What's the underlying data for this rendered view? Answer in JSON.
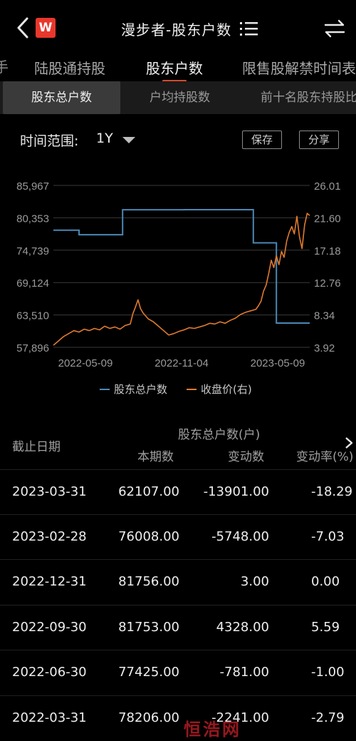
{
  "header": {
    "title": "漫步者-股东户数",
    "logo_text": "W"
  },
  "tabs": [
    {
      "label": "陆股通持股"
    },
    {
      "label": "股东户数"
    },
    {
      "label": "限售股解禁时间表"
    }
  ],
  "subtabs": [
    {
      "label": "股东总户数"
    },
    {
      "label": "户均持股数"
    },
    {
      "label": "前十名股东持股比例"
    }
  ],
  "range": {
    "label": "时间范围:",
    "value": "1Y",
    "save_label": "保存",
    "share_label": "分享"
  },
  "chart_data": {
    "type": "line",
    "left_axis_ticks": [
      "85,967",
      "80,353",
      "74,739",
      "69,124",
      "63,510",
      "57,896"
    ],
    "right_axis_ticks": [
      "26.01",
      "21.60",
      "17.18",
      "12.76",
      "8.34",
      "3.92"
    ],
    "x_tick_labels": [
      "2022-05-09",
      "2022-11-04",
      "2023-05-09"
    ],
    "ylim_left": [
      57896,
      85967
    ],
    "ylim_right": [
      3.92,
      26.01
    ],
    "legend": [
      "股东总户数",
      "收盘价(右)"
    ],
    "series": [
      {
        "name": "股东总户数",
        "color": "#4a88b5",
        "step_points": [
          [
            0,
            78206
          ],
          [
            0.1,
            78206
          ],
          [
            0.1,
            77425
          ],
          [
            0.27,
            77425
          ],
          [
            0.27,
            81753
          ],
          [
            0.51,
            81753
          ],
          [
            0.51,
            81756
          ],
          [
            0.78,
            81756
          ],
          [
            0.78,
            76008
          ],
          [
            0.87,
            76008
          ],
          [
            0.87,
            62107
          ],
          [
            1.0,
            62107
          ]
        ]
      },
      {
        "name": "收盘价(右)",
        "color": "#e07a2e",
        "points": [
          [
            0,
            4.2
          ],
          [
            0.02,
            4.8
          ],
          [
            0.04,
            5.4
          ],
          [
            0.06,
            5.8
          ],
          [
            0.08,
            6.2
          ],
          [
            0.1,
            6.0
          ],
          [
            0.12,
            6.4
          ],
          [
            0.14,
            6.2
          ],
          [
            0.16,
            6.5
          ],
          [
            0.18,
            6.3
          ],
          [
            0.2,
            6.8
          ],
          [
            0.22,
            6.5
          ],
          [
            0.24,
            6.7
          ],
          [
            0.26,
            6.4
          ],
          [
            0.28,
            6.9
          ],
          [
            0.3,
            7.1
          ],
          [
            0.31,
            8.5
          ],
          [
            0.32,
            9.4
          ],
          [
            0.33,
            10.4
          ],
          [
            0.34,
            9.2
          ],
          [
            0.35,
            8.6
          ],
          [
            0.37,
            7.8
          ],
          [
            0.39,
            7.4
          ],
          [
            0.41,
            6.8
          ],
          [
            0.43,
            6.2
          ],
          [
            0.45,
            5.6
          ],
          [
            0.47,
            5.8
          ],
          [
            0.49,
            6.1
          ],
          [
            0.51,
            6.3
          ],
          [
            0.53,
            6.6
          ],
          [
            0.55,
            6.5
          ],
          [
            0.57,
            6.7
          ],
          [
            0.59,
            6.9
          ],
          [
            0.61,
            7.2
          ],
          [
            0.63,
            7.1
          ],
          [
            0.65,
            7.4
          ],
          [
            0.67,
            7.2
          ],
          [
            0.69,
            7.6
          ],
          [
            0.71,
            7.9
          ],
          [
            0.73,
            8.4
          ],
          [
            0.75,
            8.7
          ],
          [
            0.77,
            8.9
          ],
          [
            0.79,
            9.1
          ],
          [
            0.8,
            9.6
          ],
          [
            0.81,
            10.2
          ],
          [
            0.82,
            11.6
          ],
          [
            0.83,
            12.4
          ],
          [
            0.84,
            14.0
          ],
          [
            0.85,
            15.8
          ],
          [
            0.86,
            14.8
          ],
          [
            0.87,
            16.4
          ],
          [
            0.88,
            15.2
          ],
          [
            0.89,
            17.0
          ],
          [
            0.9,
            16.2
          ],
          [
            0.91,
            18.4
          ],
          [
            0.92,
            19.6
          ],
          [
            0.93,
            20.4
          ],
          [
            0.94,
            19.4
          ],
          [
            0.95,
            21.8
          ],
          [
            0.96,
            19.0
          ],
          [
            0.97,
            17.4
          ],
          [
            0.98,
            20.6
          ],
          [
            0.99,
            22.2
          ],
          [
            1.0,
            21.9
          ]
        ]
      }
    ]
  },
  "table": {
    "date_header": "截止日期",
    "group_header": "股东总户数(户)",
    "col_headers": [
      "本期数",
      "变动数",
      "变动率(%)"
    ],
    "rows": [
      {
        "date": "2023-03-31",
        "count": "62107.00",
        "change": "-13901.00",
        "rate": "-18.29"
      },
      {
        "date": "2023-02-28",
        "count": "76008.00",
        "change": "-5748.00",
        "rate": "-7.03"
      },
      {
        "date": "2022-12-31",
        "count": "81756.00",
        "change": "3.00",
        "rate": "0.00"
      },
      {
        "date": "2022-09-30",
        "count": "81753.00",
        "change": "4328.00",
        "rate": "5.59"
      },
      {
        "date": "2022-06-30",
        "count": "77425.00",
        "change": "-781.00",
        "rate": "-1.00"
      },
      {
        "date": "2022-03-31",
        "count": "78206.00",
        "change": "-2241.00",
        "rate": "-2.79"
      }
    ]
  },
  "watermark": "恒浩网"
}
